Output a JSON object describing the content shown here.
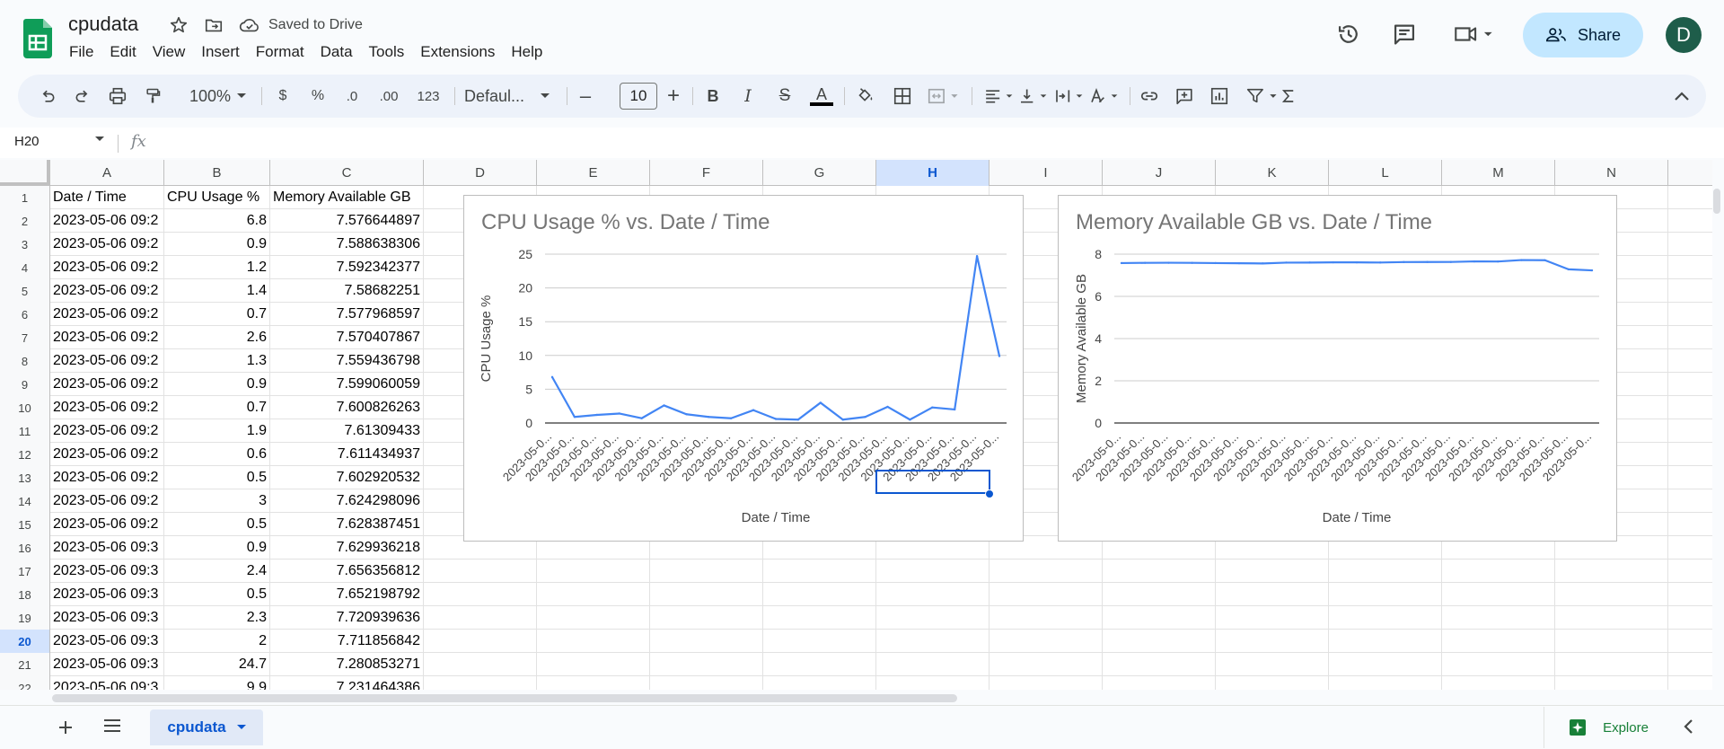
{
  "document": {
    "title": "cpudata",
    "status": "Saved to Drive"
  },
  "menu": [
    "File",
    "Edit",
    "View",
    "Insert",
    "Format",
    "Data",
    "Tools",
    "Extensions",
    "Help"
  ],
  "header": {
    "share_label": "Share",
    "avatar_letter": "D"
  },
  "toolbar": {
    "zoom": "100%",
    "currency": "$",
    "percent": "%",
    "decrease_decimal": ".0",
    "increase_decimal": ".00",
    "number_format": "123",
    "font": "Defaul...",
    "font_size": "10",
    "minus": "–",
    "plus": "+",
    "bold": "B",
    "italic": "I",
    "strike": "S",
    "text_color": "A"
  },
  "formula_bar": {
    "name_box": "H20",
    "fx": "fx"
  },
  "grid": {
    "columns": [
      "A",
      "B",
      "C",
      "D",
      "E",
      "F",
      "G",
      "H",
      "I",
      "J",
      "K",
      "L",
      "M",
      "N"
    ],
    "header_row": [
      "Date / Time",
      "CPU Usage %",
      "Memory Available GB"
    ],
    "rows": [
      {
        "n": "1",
        "a": "Date / Time",
        "b": "CPU Usage %",
        "c": "Memory Available GB"
      },
      {
        "n": "2",
        "a": "2023-05-06 09:2",
        "b": "6.8",
        "c": "7.576644897"
      },
      {
        "n": "3",
        "a": "2023-05-06 09:2",
        "b": "0.9",
        "c": "7.588638306"
      },
      {
        "n": "4",
        "a": "2023-05-06 09:2",
        "b": "1.2",
        "c": "7.592342377"
      },
      {
        "n": "5",
        "a": "2023-05-06 09:2",
        "b": "1.4",
        "c": "7.58682251"
      },
      {
        "n": "6",
        "a": "2023-05-06 09:2",
        "b": "0.7",
        "c": "7.577968597"
      },
      {
        "n": "7",
        "a": "2023-05-06 09:2",
        "b": "2.6",
        "c": "7.570407867"
      },
      {
        "n": "8",
        "a": "2023-05-06 09:2",
        "b": "1.3",
        "c": "7.559436798"
      },
      {
        "n": "9",
        "a": "2023-05-06 09:2",
        "b": "0.9",
        "c": "7.599060059"
      },
      {
        "n": "10",
        "a": "2023-05-06 09:2",
        "b": "0.7",
        "c": "7.600826263"
      },
      {
        "n": "11",
        "a": "2023-05-06 09:2",
        "b": "1.9",
        "c": "7.61309433"
      },
      {
        "n": "12",
        "a": "2023-05-06 09:2",
        "b": "0.6",
        "c": "7.611434937"
      },
      {
        "n": "13",
        "a": "2023-05-06 09:2",
        "b": "0.5",
        "c": "7.602920532"
      },
      {
        "n": "14",
        "a": "2023-05-06 09:2",
        "b": "3",
        "c": "7.624298096"
      },
      {
        "n": "15",
        "a": "2023-05-06 09:2",
        "b": "0.5",
        "c": "7.628387451"
      },
      {
        "n": "16",
        "a": "2023-05-06 09:3",
        "b": "0.9",
        "c": "7.629936218"
      },
      {
        "n": "17",
        "a": "2023-05-06 09:3",
        "b": "2.4",
        "c": "7.656356812"
      },
      {
        "n": "18",
        "a": "2023-05-06 09:3",
        "b": "0.5",
        "c": "7.652198792"
      },
      {
        "n": "19",
        "a": "2023-05-06 09:3",
        "b": "2.3",
        "c": "7.720939636"
      },
      {
        "n": "20",
        "a": "2023-05-06 09:3",
        "b": "2",
        "c": "7.711856842"
      },
      {
        "n": "21",
        "a": "2023-05-06 09:3",
        "b": "24.7",
        "c": "7.280853271"
      },
      {
        "n": "22",
        "a": "2023-05-06 09:3",
        "b": "9.9",
        "c": "7.231464386"
      }
    ],
    "selected_column": "H",
    "selected_row": "20"
  },
  "chart_data": [
    {
      "type": "line",
      "title": "CPU Usage % vs. Date / Time",
      "xlabel": "Date / Time",
      "ylabel": "CPU Usage %",
      "tick_label": "2023-05-0...",
      "y_ticks": [
        "0",
        "5",
        "10",
        "15",
        "20",
        "25"
      ],
      "ylim": [
        0,
        25
      ],
      "values": [
        6.8,
        0.9,
        1.2,
        1.4,
        0.7,
        2.6,
        1.3,
        0.9,
        0.7,
        1.9,
        0.6,
        0.5,
        3,
        0.5,
        0.9,
        2.4,
        0.5,
        2.3,
        2,
        24.7,
        9.9
      ],
      "grid": true,
      "color": "#4285f4"
    },
    {
      "type": "line",
      "title": "Memory Available GB vs. Date / Time",
      "xlabel": "Date / Time",
      "ylabel": "Memory Available GB",
      "tick_label": "2023-05-0...",
      "y_ticks": [
        "0",
        "2",
        "4",
        "6",
        "8"
      ],
      "ylim": [
        0,
        8
      ],
      "values": [
        7.576644897,
        7.588638306,
        7.592342377,
        7.58682251,
        7.577968597,
        7.570407867,
        7.559436798,
        7.599060059,
        7.600826263,
        7.61309433,
        7.611434937,
        7.602920532,
        7.624298096,
        7.628387451,
        7.629936218,
        7.656356812,
        7.652198792,
        7.720939636,
        7.711856842,
        7.280853271,
        7.231464386
      ],
      "grid": true,
      "color": "#4285f4"
    }
  ],
  "bottom_bar": {
    "sheet_name": "cpudata",
    "explore_label": "Explore"
  },
  "colors": {
    "accent": "#0b57d0",
    "share_bg": "#c2e7ff",
    "sheets_green": "#0f9d58",
    "series_line": "#4285f4"
  },
  "icons": [
    "sheets-logo-icon",
    "star-icon",
    "move-folder-icon",
    "cloud-saved-icon",
    "history-icon",
    "comment-icon",
    "video-call-icon",
    "people-icon",
    "undo-icon",
    "redo-icon",
    "print-icon",
    "paint-format-icon",
    "fill-color-icon",
    "borders-icon",
    "merge-icon",
    "align-icon",
    "valign-icon",
    "wrap-icon",
    "rotate-icon",
    "link-icon",
    "add-comment-icon",
    "insert-chart-icon",
    "filter-icon",
    "functions-icon",
    "collapse-icon",
    "explore-icon"
  ]
}
